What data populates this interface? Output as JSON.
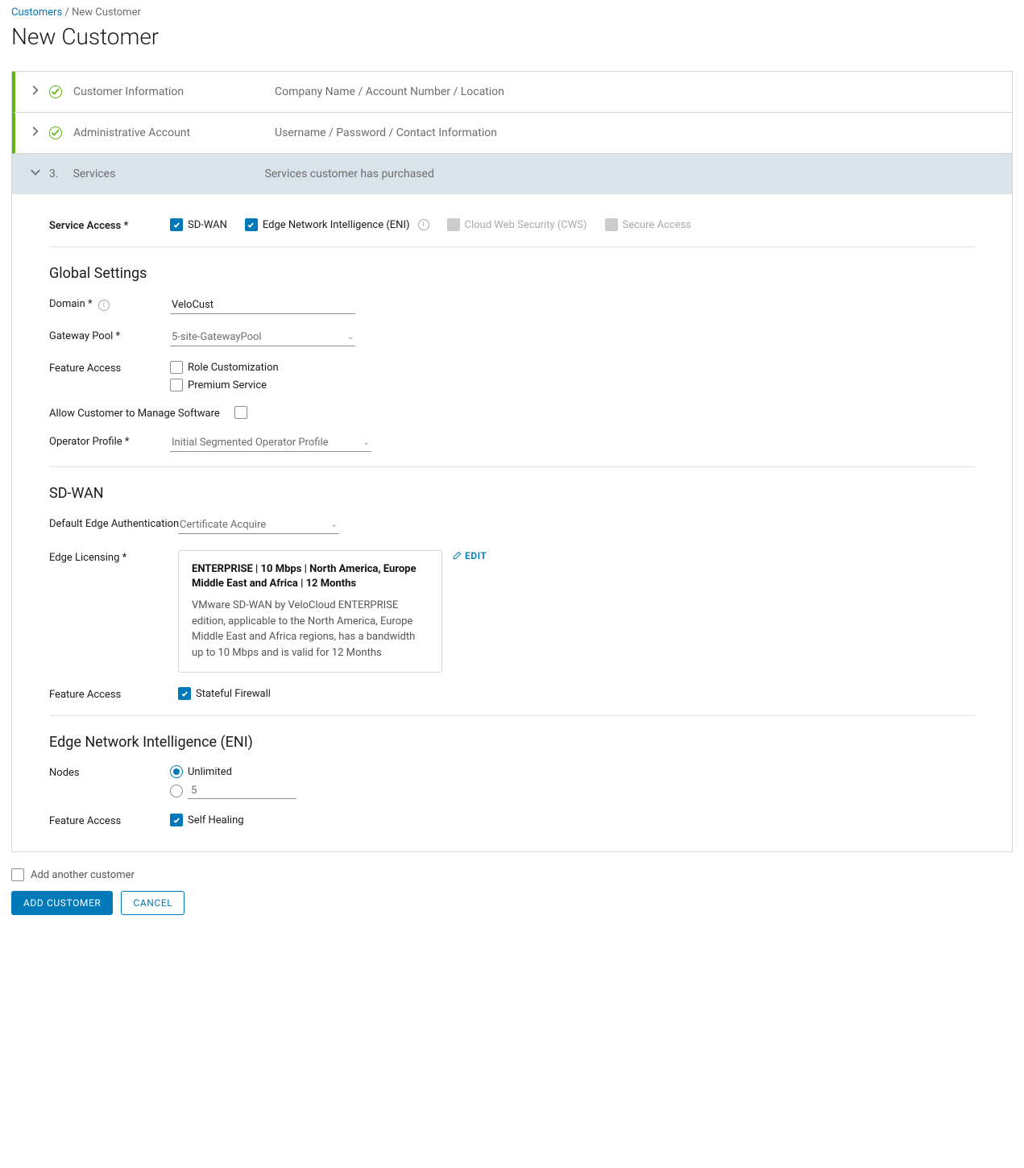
{
  "breadcrumb": {
    "link": "Customers",
    "sep": "/",
    "current": "New Customer"
  },
  "pageTitle": "New Customer",
  "steps": {
    "s1": {
      "label": "Customer Information",
      "desc": "Company Name / Account Number / Location"
    },
    "s2": {
      "label": "Administrative Account",
      "desc": "Username / Password / Contact Information"
    },
    "s3": {
      "num": "3.",
      "label": "Services",
      "desc": "Services customer has purchased"
    }
  },
  "serviceAccess": {
    "label": "Service Access *",
    "sdwan": "SD-WAN",
    "eni": "Edge Network Intelligence (ENI)",
    "cws": "Cloud Web Security (CWS)",
    "secure": "Secure Access"
  },
  "global": {
    "title": "Global Settings",
    "domainLabel": "Domain *",
    "domainValue": "VeloCust",
    "gatewayLabel": "Gateway Pool *",
    "gatewayValue": "5-site-GatewayPool",
    "featureLabel": "Feature Access",
    "roleCust": "Role Customization",
    "premium": "Premium Service",
    "allowManage": "Allow Customer to Manage Software",
    "opProfileLabel": "Operator Profile *",
    "opProfileValue": "Initial Segmented Operator Profile"
  },
  "sdwan": {
    "title": "SD-WAN",
    "defaultEdgeAuth": "Default Edge Authentication",
    "defaultEdgeAuthValue": "Certificate Acquire",
    "edgeLicLabel": "Edge Licensing *",
    "edgeLicTitle": "ENTERPRISE | 10 Mbps | North America, Europe Middle East and Africa | 12 Months",
    "edgeLicDesc": "VMware SD-WAN by VeloCloud ENTERPRISE edition, applicable to the North America, Europe Middle East and Africa regions, has a bandwidth up to 10 Mbps and is valid for 12 Months",
    "edit": "EDIT",
    "featureLabel": "Feature Access",
    "stateful": "Stateful Firewall"
  },
  "eni": {
    "title": "Edge Network Intelligence (ENI)",
    "nodesLabel": "Nodes",
    "unlimited": "Unlimited",
    "nodesValue": "5",
    "featureLabel": "Feature Access",
    "selfHealing": "Self Healing"
  },
  "footer": {
    "addAnother": "Add another customer",
    "addCustomer": "ADD CUSTOMER",
    "cancel": "CANCEL"
  }
}
